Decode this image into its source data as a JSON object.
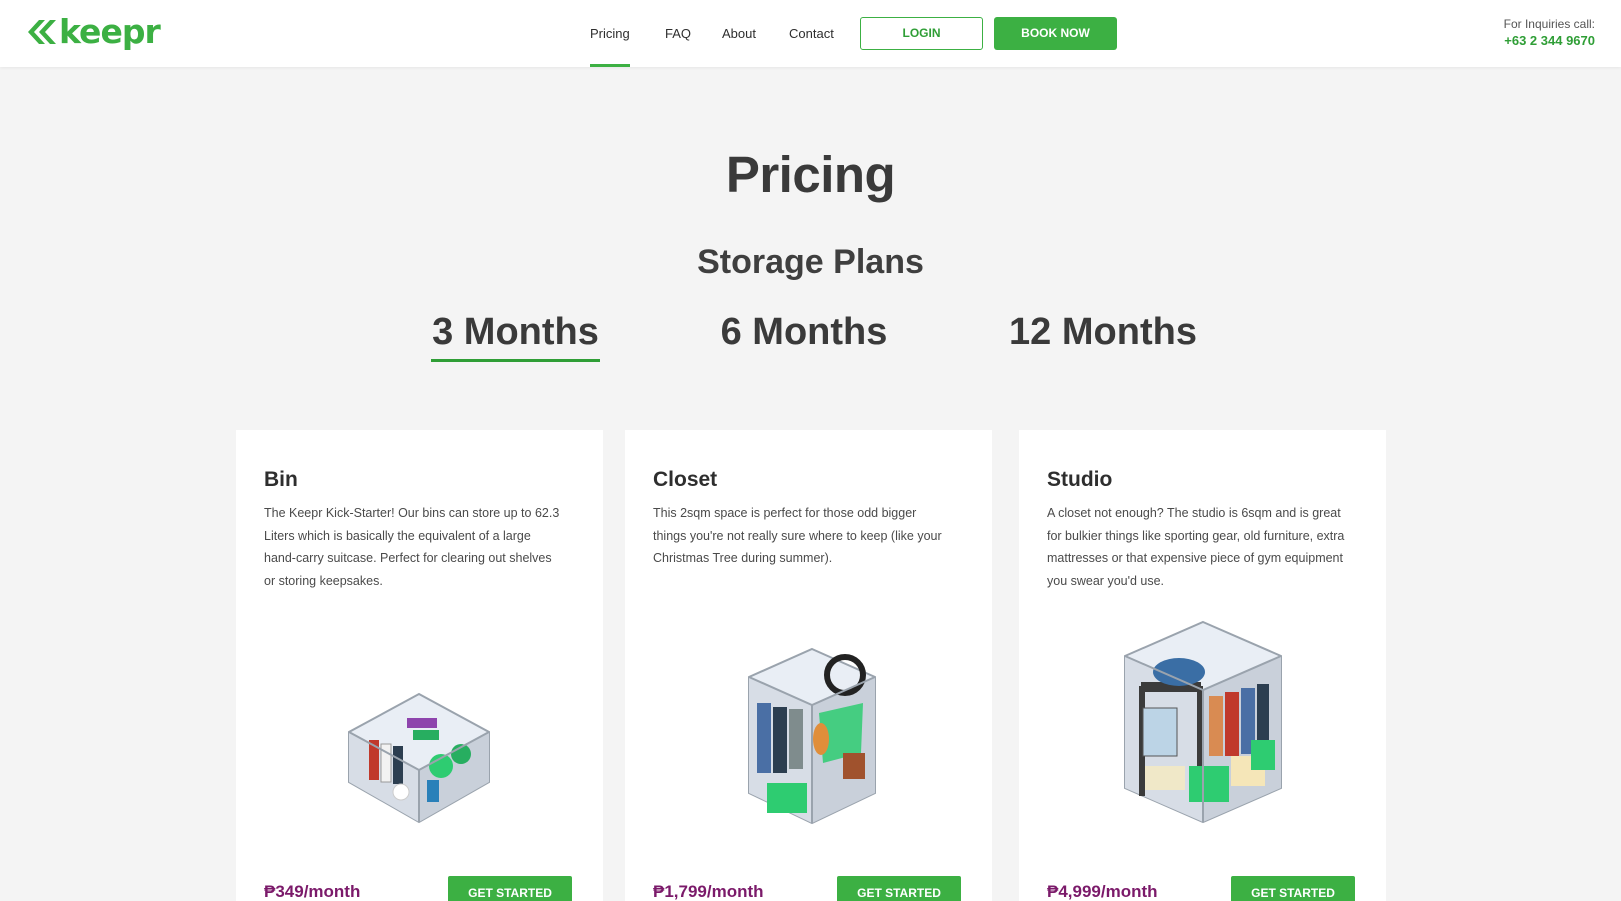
{
  "brand": {
    "name": "keepr",
    "color": "#3cb043",
    "price_color": "#7b1a6a"
  },
  "nav": {
    "items": [
      {
        "label": "Pricing",
        "active": true
      },
      {
        "label": "FAQ",
        "active": false
      },
      {
        "label": "About",
        "active": false
      },
      {
        "label": "Contact",
        "active": false
      }
    ],
    "login_label": "LOGIN",
    "book_label": "BOOK NOW"
  },
  "inquiry": {
    "label": "For Inquiries call:",
    "phone": "+63 2 344 9670"
  },
  "page": {
    "title": "Pricing",
    "section_title": "Storage Plans"
  },
  "tabs": [
    {
      "label": "3 Months",
      "active": true
    },
    {
      "label": "6 Months",
      "active": false
    },
    {
      "label": "12 Months",
      "active": false
    }
  ],
  "plans": [
    {
      "name": "Bin",
      "description": "The Keepr Kick-Starter! Our bins can store up to 62.3 Liters which is basically the equivalent of a large hand-carry suitcase. Perfect for clearing out shelves or storing keepsakes.",
      "price": "₱349/month",
      "cta": "GET STARTED",
      "illustration": "storage-bin-illustration"
    },
    {
      "name": "Closet",
      "description": "This 2sqm space is perfect for those odd bigger things you're not really sure where to keep (like your Christmas Tree during summer).",
      "price": "₱1,799/month",
      "cta": "GET STARTED",
      "illustration": "storage-closet-illustration"
    },
    {
      "name": "Studio",
      "description": "A closet not enough? The studio is 6sqm and is great for bulkier things like sporting gear, old furniture, extra mattresses or that expensive piece of gym equipment you swear you'd use.",
      "price": "₱4,999/month",
      "cta": "GET STARTED",
      "illustration": "storage-studio-illustration"
    }
  ]
}
